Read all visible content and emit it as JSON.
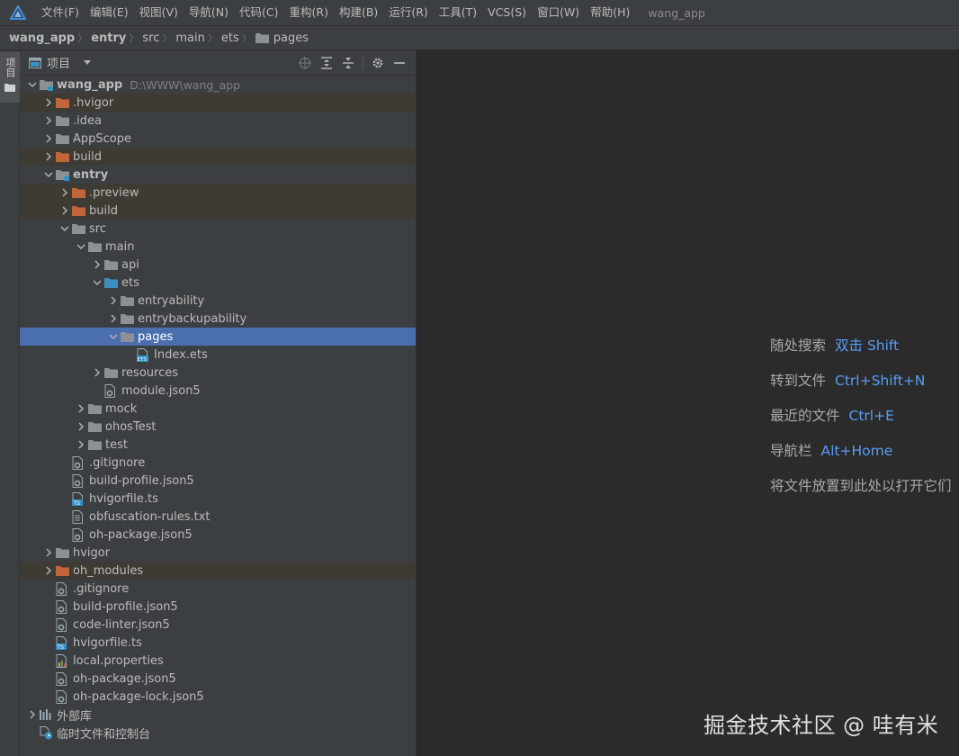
{
  "menubar": {
    "items": [
      "文件(F)",
      "编辑(E)",
      "视图(V)",
      "导航(N)",
      "代码(C)",
      "重构(R)",
      "构建(B)",
      "运行(R)",
      "工具(T)",
      "VCS(S)",
      "窗口(W)",
      "帮助(H)"
    ],
    "window_title": "wang_app"
  },
  "breadcrumb": [
    "wang_app",
    "entry",
    "src",
    "main",
    "ets",
    "pages"
  ],
  "left_strip": {
    "tab_label": "项目"
  },
  "project_panel": {
    "title": "项目",
    "tree": [
      {
        "label": "wang_app",
        "hint": "D:\\WWW\\wang_app"
      },
      {
        "label": ".hvigor"
      },
      {
        "label": ".idea"
      },
      {
        "label": "AppScope"
      },
      {
        "label": "build"
      },
      {
        "label": "entry"
      },
      {
        "label": ".preview"
      },
      {
        "label": "build"
      },
      {
        "label": "src"
      },
      {
        "label": "main"
      },
      {
        "label": "api"
      },
      {
        "label": "ets"
      },
      {
        "label": "entryability"
      },
      {
        "label": "entrybackupability"
      },
      {
        "label": "pages"
      },
      {
        "label": "Index.ets"
      },
      {
        "label": "resources"
      },
      {
        "label": "module.json5"
      },
      {
        "label": "mock"
      },
      {
        "label": "ohosTest"
      },
      {
        "label": "test"
      },
      {
        "label": ".gitignore"
      },
      {
        "label": "build-profile.json5"
      },
      {
        "label": "hvigorfile.ts"
      },
      {
        "label": "obfuscation-rules.txt"
      },
      {
        "label": "oh-package.json5"
      },
      {
        "label": "hvigor"
      },
      {
        "label": "oh_modules"
      },
      {
        "label": ".gitignore"
      },
      {
        "label": "build-profile.json5"
      },
      {
        "label": "code-linter.json5"
      },
      {
        "label": "hvigorfile.ts"
      },
      {
        "label": "local.properties"
      },
      {
        "label": "oh-package.json5"
      },
      {
        "label": "oh-package-lock.json5"
      },
      {
        "label": "外部库"
      },
      {
        "label": "临时文件和控制台"
      }
    ]
  },
  "editor": {
    "tips": [
      {
        "text": "随处搜索",
        "key": "双击 Shift"
      },
      {
        "text": "转到文件",
        "key": "Ctrl+Shift+N"
      },
      {
        "text": "最近的文件",
        "key": "Ctrl+E"
      },
      {
        "text": "导航栏",
        "key": "Alt+Home"
      },
      {
        "text": "将文件放置到此处以打开它们",
        "key": ""
      }
    ],
    "watermark": "掘金技术社区 @ 哇有米"
  },
  "colors": {
    "accent": "#4b6eaf",
    "shortcut": "#589df6",
    "folder": "#8c9194",
    "excluded_folder": "#c3653b",
    "source_folder": "#3d8fbf"
  }
}
